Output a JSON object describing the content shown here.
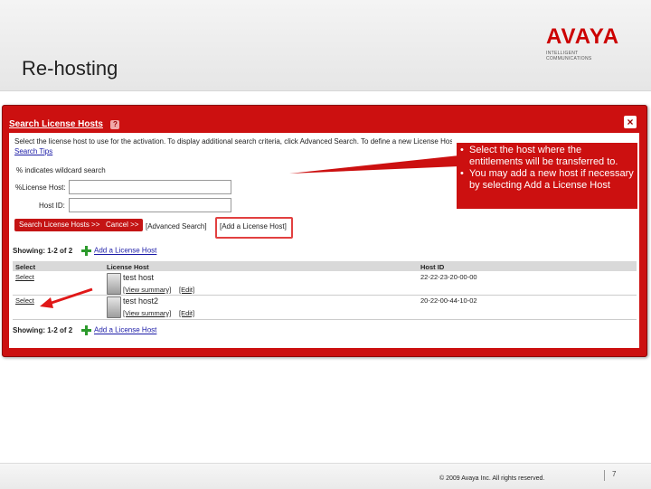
{
  "slide": {
    "title": "Re-hosting",
    "logo_word": "AVAYA",
    "logo_sub": "INTELLIGENT COMMUNICATIONS",
    "copyright": "© 2009 Avaya Inc. All rights reserved.",
    "page_number": "7"
  },
  "panel": {
    "title": "Search License Hosts",
    "help_glyph": "?",
    "close_glyph": "×",
    "instructions": "Select the license host to use for the activation. To display additional search criteria, click Advanced Search. To define a new License Host, click Add a License Host. Click here for additional",
    "search_tips_link": "Search Tips",
    "wildcard_note": "% indicates wildcard search",
    "license_host_label": "%License Host:",
    "host_id_label": "Host ID:",
    "search_button": "Search License Hosts >>",
    "cancel_button": "Cancel >>",
    "advanced_search": "[Advanced Search]",
    "add_host_bracket": "[Add a License Host]",
    "showing": "Showing: 1-2 of 2",
    "add_host_link": "Add a License Host",
    "columns": [
      "Select",
      "License Host",
      "Host ID"
    ],
    "rows": [
      {
        "select": "Select",
        "host": "test host",
        "view": "[View summary]",
        "edit": "[Edit]",
        "host_id": "22-22-23-20-00-00"
      },
      {
        "select": "Select",
        "host": "test host2",
        "view": "[View summary]",
        "edit": "[Edit]",
        "host_id": "20-22-00-44-10-02"
      }
    ]
  },
  "callout": {
    "bullets": [
      "Select the host where the entitlements will be transferred to.",
      "You may add a new host if necessary by selecting Add a License Host"
    ]
  },
  "colors": {
    "accent": "#cc1010",
    "brand": "#cc0000"
  }
}
